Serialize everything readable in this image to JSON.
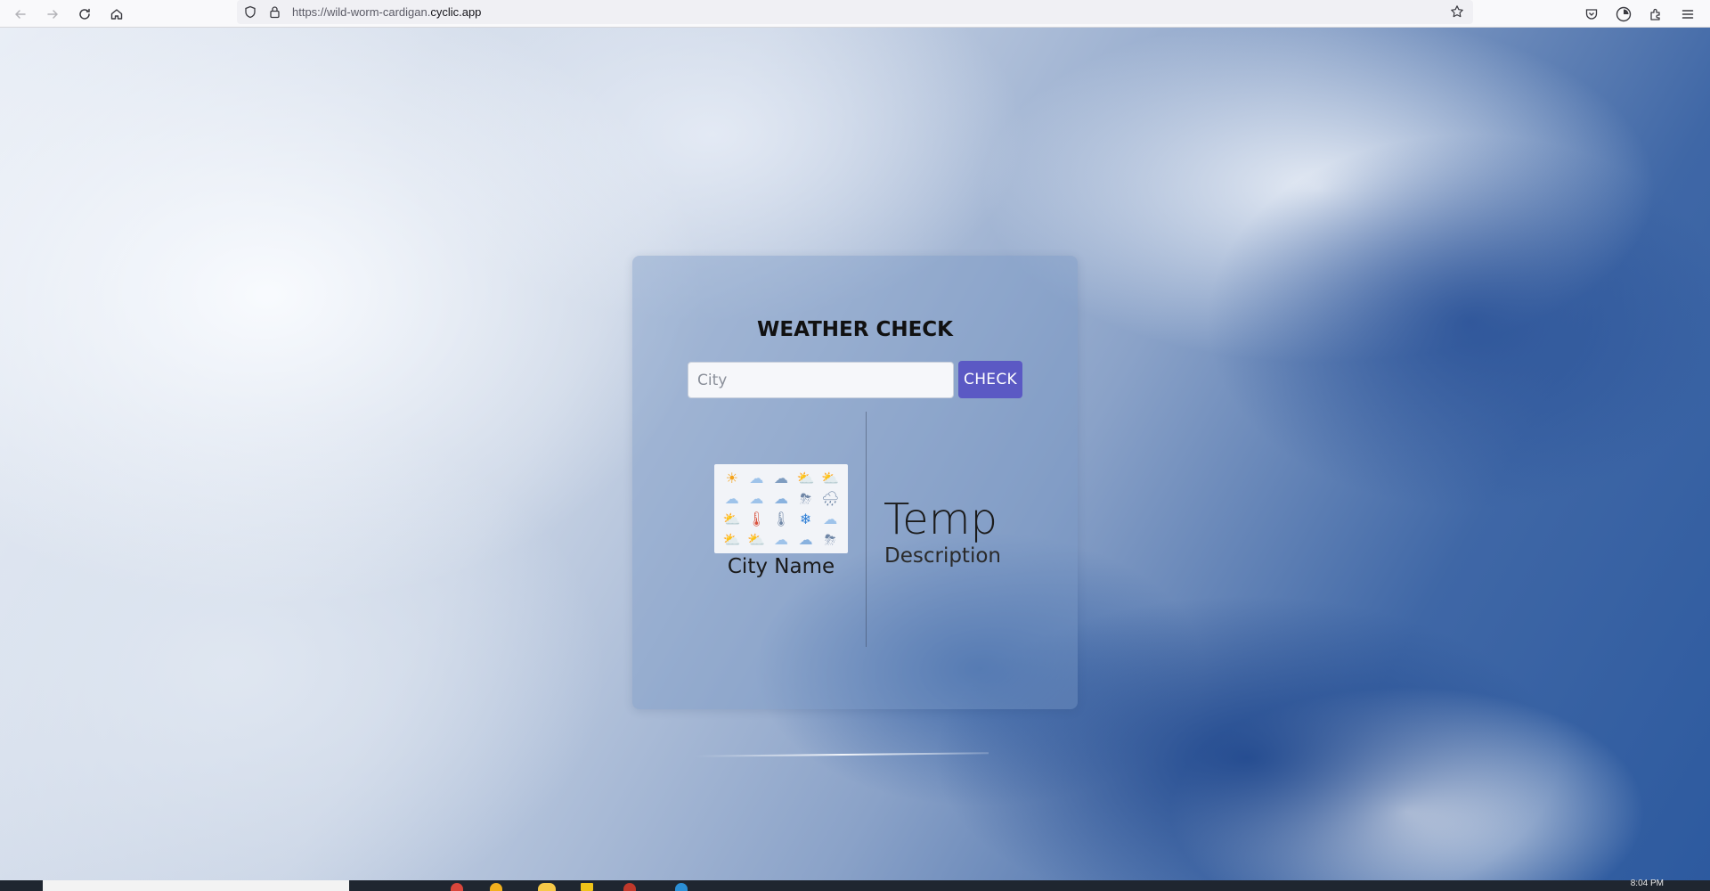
{
  "browser": {
    "url_prefix": "https://wild-worm-cardigan.",
    "url_host": "cyclic.app",
    "icons": [
      "back-arrow-icon",
      "forward-arrow-icon",
      "reload-icon",
      "home-icon",
      "shield-icon",
      "lock-icon",
      "star-icon",
      "pocket-icon",
      "account-icon",
      "extensions-icon",
      "menu-icon"
    ]
  },
  "app": {
    "title": "WEATHER CHECK",
    "input_placeholder": "City",
    "input_value": "",
    "check_label": "CHECK",
    "city_name": "City Name",
    "temp": "Temp",
    "description": "Description",
    "weather_icons": [
      "☀",
      "☁",
      "☁",
      "⛅",
      "⛅",
      "☁",
      "☁",
      "☁",
      "⛈",
      "🌧",
      "⛅",
      "🌡",
      "🌡",
      "❄",
      "☁",
      "⛅",
      "⛅",
      "☁",
      "☁",
      "⛈"
    ]
  },
  "taskbar": {
    "time": "8:04 PM"
  },
  "colors": {
    "accent": "#5b59c4",
    "card_bg": "rgba(120,150,195,0.42)"
  }
}
